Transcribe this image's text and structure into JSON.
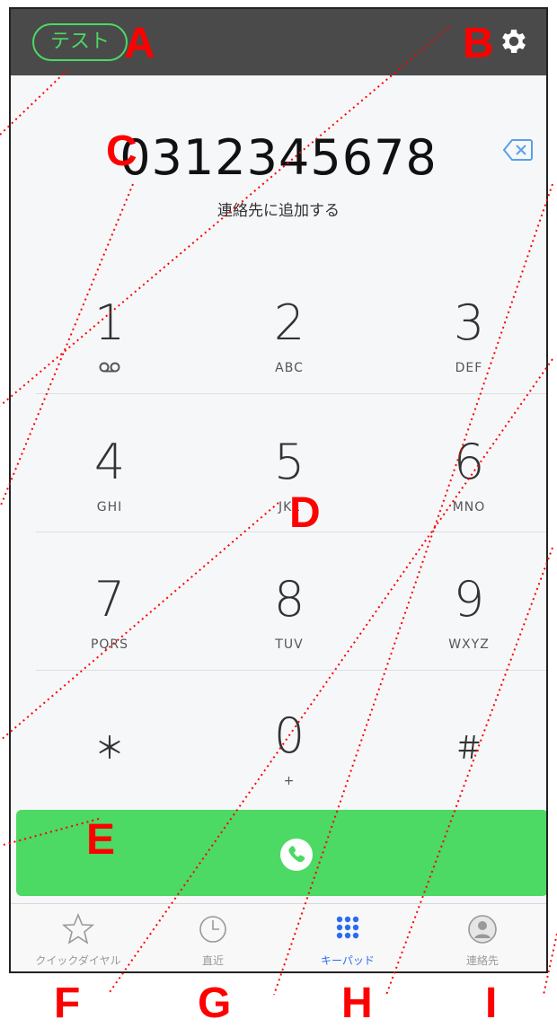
{
  "header": {
    "account_label": "テスト"
  },
  "dial": {
    "number": "0312345678",
    "add_contact": "連絡先に追加する"
  },
  "keypad": [
    {
      "digit": "1",
      "letters": ""
    },
    {
      "digit": "2",
      "letters": "ABC"
    },
    {
      "digit": "3",
      "letters": "DEF"
    },
    {
      "digit": "4",
      "letters": "GHI"
    },
    {
      "digit": "5",
      "letters": "JKL"
    },
    {
      "digit": "6",
      "letters": "MNO"
    },
    {
      "digit": "7",
      "letters": "PQRS"
    },
    {
      "digit": "8",
      "letters": "TUV"
    },
    {
      "digit": "9",
      "letters": "WXYZ"
    },
    {
      "digit": "＊",
      "letters": ""
    },
    {
      "digit": "0",
      "letters": "+"
    },
    {
      "digit": "＃",
      "letters": ""
    }
  ],
  "tabs": [
    {
      "label": "クイックダイヤル",
      "icon": "star-icon"
    },
    {
      "label": "直近",
      "icon": "clock-icon"
    },
    {
      "label": "キーパッド",
      "icon": "keypad-icon",
      "active": true
    },
    {
      "label": "連絡先",
      "icon": "contact-icon"
    }
  ],
  "callouts": {
    "a": "A",
    "b": "B",
    "c": "C",
    "d": "D",
    "e": "E",
    "f": "F",
    "g": "G",
    "h": "H",
    "i": "I"
  },
  "colors": {
    "accent_green": "#4cd964",
    "active_blue": "#2a6cf0",
    "header_bg": "#4a4a4a",
    "callout_red": "#ff0000"
  }
}
